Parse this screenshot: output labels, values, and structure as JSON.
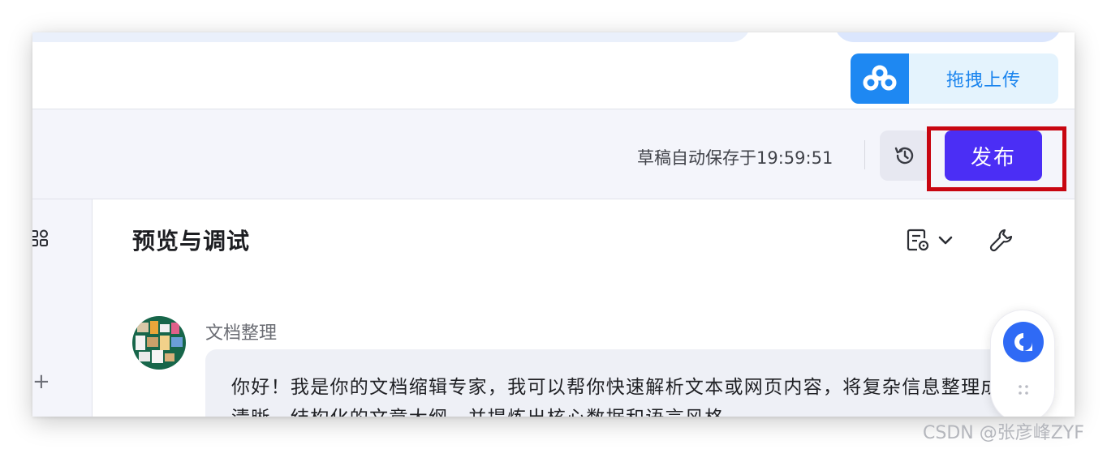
{
  "upload": {
    "label": "拖拽上传",
    "logo": "cloud-drive-logo",
    "accent": "#1e88f2"
  },
  "toolbar": {
    "autosave_text": "草稿自动保存于19:59:51",
    "history_icon": "history-icon",
    "publish_label": "发布",
    "publish_color": "#4b2ef5",
    "highlight_color": "#c80611"
  },
  "left_panel": {
    "icon": "apps-grid-icon",
    "add_label": "+"
  },
  "preview": {
    "title": "预览与调试",
    "doc_icon": "document-settings-icon",
    "dropdown_icon": "chevron-down-icon",
    "wrench_icon": "wrench-icon"
  },
  "chat": {
    "bot_name": "文档整理",
    "message": "你好！我是你的文档缩辑专家，我可以帮你快速解析文本或网页内容，将复杂信息整理成清晰、结构化的文章大纲，并提炼出核心数据和语言风格。"
  },
  "dock": {
    "icon": "assistant-icon",
    "grip": "drag-handle-icon"
  },
  "watermark": "CSDN @张彦峰ZYF"
}
